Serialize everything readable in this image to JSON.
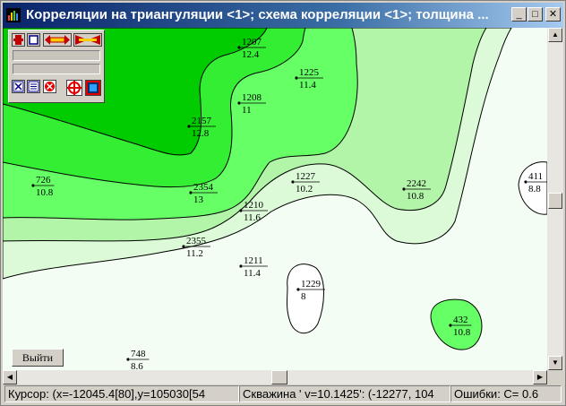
{
  "window": {
    "title": "Корреляции на триангуляции <1>; схема корреляции <1>; толщина ...",
    "minimize_glyph": "_",
    "maximize_glyph": "□",
    "close_glyph": "✕"
  },
  "colors": {
    "level_lightest": "#f4fdf3",
    "level_1": "#dcfad8",
    "level_2": "#b2f5a8",
    "level_3": "#66ff66",
    "level_4": "#33ee33",
    "level_5": "#00cc00",
    "title_gradient_start": "#0a246a"
  },
  "wells": [
    {
      "id": "1207",
      "value": "12.4"
    },
    {
      "id": "1225",
      "value": "11.4"
    },
    {
      "id": "1208",
      "value": "11"
    },
    {
      "id": "2157",
      "value": "12.8"
    },
    {
      "id": "726",
      "value": "10.8"
    },
    {
      "id": "2354",
      "value": "13"
    },
    {
      "id": "1227",
      "value": "10.2"
    },
    {
      "id": "2242",
      "value": "10.8"
    },
    {
      "id": "411",
      "value": "8.8"
    },
    {
      "id": "1210",
      "value": "11.6"
    },
    {
      "id": "2355",
      "value": "11.2"
    },
    {
      "id": "1211",
      "value": "11.4"
    },
    {
      "id": "1229",
      "value": "8"
    },
    {
      "id": "432",
      "value": "10.8"
    },
    {
      "id": "748",
      "value": "8.6"
    }
  ],
  "toolbox": {
    "icons": [
      "move-icon",
      "window-icon",
      "stretch-horizontal-icon",
      "shrink-horizontal-icon",
      "close-small-icon",
      "list-icon",
      "no-entry-icon",
      "target-icon",
      "image-icon"
    ]
  },
  "exit_button": {
    "label": "Выйти"
  },
  "statusbar": {
    "cursor": "Курсор: (x=-12045.4[80],y=105030[54",
    "well": "Скважина ' v=10.1425': (-12277, 104",
    "errors": "Ошибки: С= 0.6"
  }
}
